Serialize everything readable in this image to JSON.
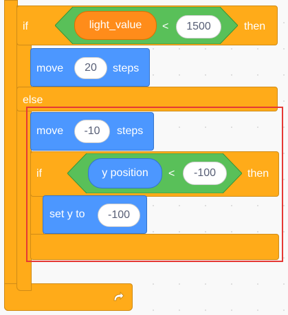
{
  "outer_if": {
    "if_label": "if",
    "then_label": "then",
    "condition": {
      "variable": "light_value",
      "operator": "<",
      "value": "1500"
    }
  },
  "move_block_1": {
    "label": "move",
    "steps": "20",
    "suffix": "steps"
  },
  "else_label": "else",
  "move_block_2": {
    "label": "move",
    "steps": "-10",
    "suffix": "steps"
  },
  "inner_if": {
    "if_label": "if",
    "then_label": "then",
    "condition": {
      "variable": "y position",
      "operator": "<",
      "value": "-100"
    }
  },
  "set_y_block": {
    "label": "set y to",
    "value": "-100"
  },
  "loop_icon": "loop-arrow-icon"
}
